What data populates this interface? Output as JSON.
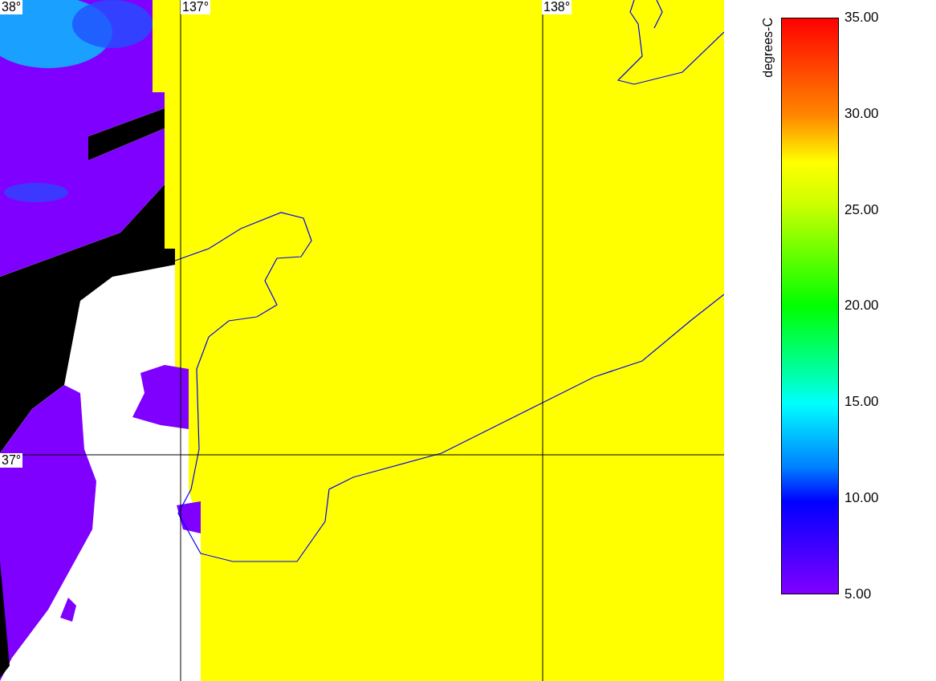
{
  "map": {
    "lat_labels": [
      "38°",
      "37°"
    ],
    "lon_labels": [
      "137°",
      "138°"
    ]
  },
  "colorbar": {
    "unit": "degrees-C",
    "ticks": [
      "35.00",
      "30.00",
      "25.00",
      "20.00",
      "15.00",
      "10.00",
      "5.00"
    ]
  }
}
